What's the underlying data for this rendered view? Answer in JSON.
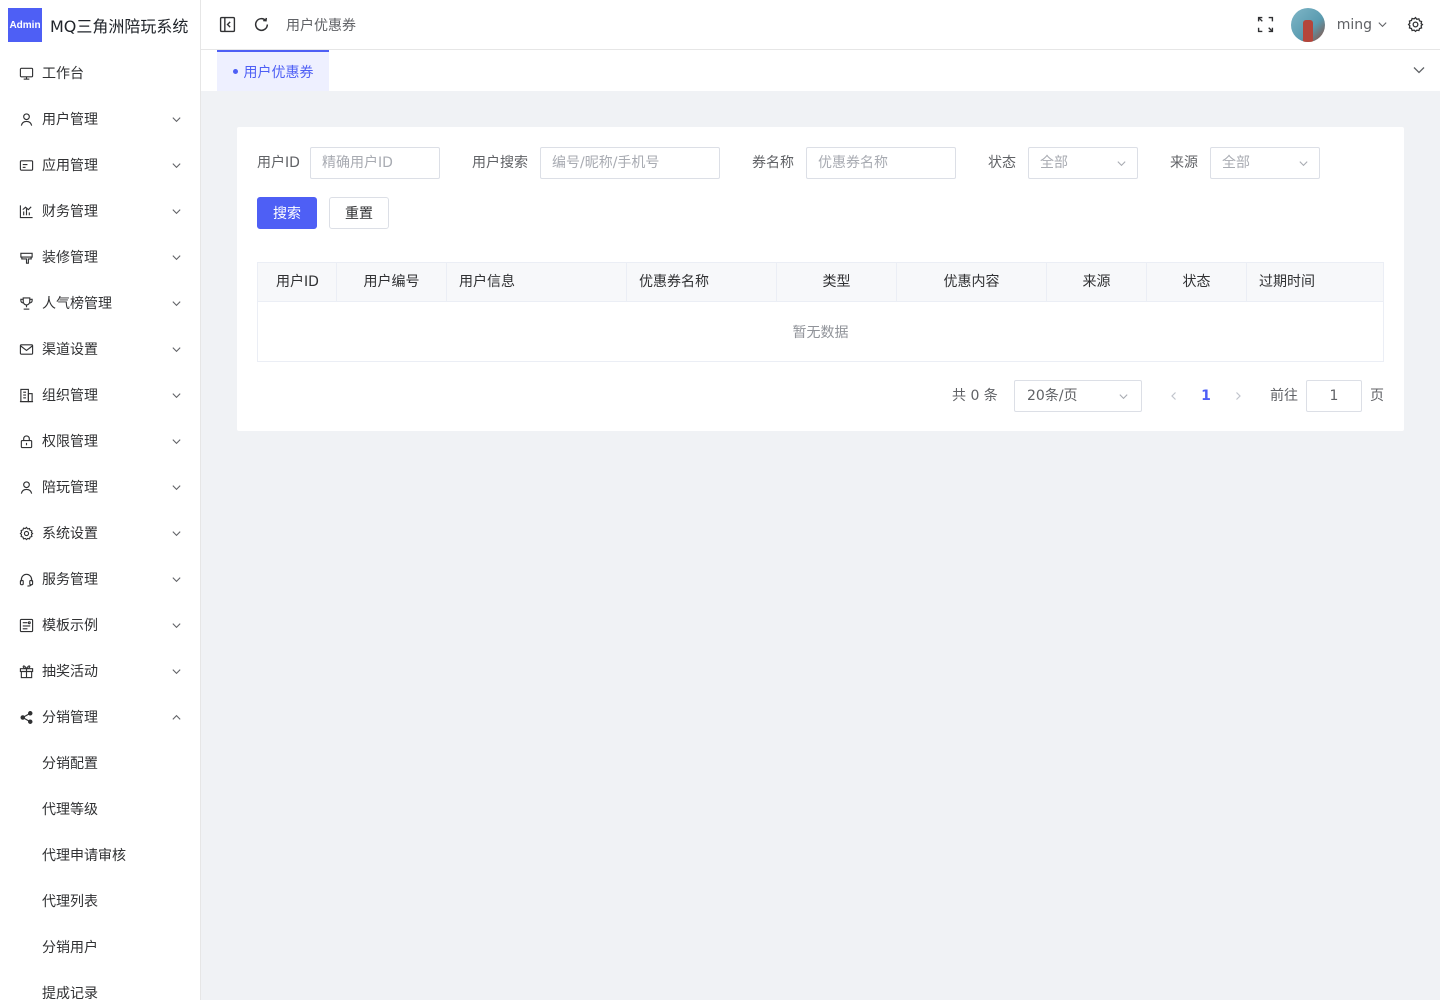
{
  "app": {
    "logo_badge": "Admin",
    "title": "MQ三角洲陪玩系统"
  },
  "sidebar": {
    "items": [
      {
        "label": "工作台",
        "icon": "monitor-icon",
        "arrow": ""
      },
      {
        "label": "用户管理",
        "icon": "user-icon",
        "arrow": "down"
      },
      {
        "label": "应用管理",
        "icon": "app-card-icon",
        "arrow": "down"
      },
      {
        "label": "财务管理",
        "icon": "bar-chart-icon",
        "arrow": "down"
      },
      {
        "label": "装修管理",
        "icon": "brush-icon",
        "arrow": "down"
      },
      {
        "label": "人气榜管理",
        "icon": "trophy-icon",
        "arrow": "down"
      },
      {
        "label": "渠道设置",
        "icon": "mail-icon",
        "arrow": "down"
      },
      {
        "label": "组织管理",
        "icon": "office-building-icon",
        "arrow": "down"
      },
      {
        "label": "权限管理",
        "icon": "lock-icon",
        "arrow": "down"
      },
      {
        "label": "陪玩管理",
        "icon": "user-icon",
        "arrow": "down"
      },
      {
        "label": "系统设置",
        "icon": "gear-icon",
        "arrow": "down"
      },
      {
        "label": "服务管理",
        "icon": "headset-icon",
        "arrow": "down"
      },
      {
        "label": "模板示例",
        "icon": "template-icon",
        "arrow": "down"
      },
      {
        "label": "抽奖活动",
        "icon": "gift-icon",
        "arrow": "down"
      },
      {
        "label": "分销管理",
        "icon": "share-icon",
        "arrow": "up"
      }
    ],
    "subitems": [
      {
        "label": "分销配置"
      },
      {
        "label": "代理等级"
      },
      {
        "label": "代理申请审核"
      },
      {
        "label": "代理列表"
      },
      {
        "label": "分销用户"
      },
      {
        "label": "提成记录"
      }
    ]
  },
  "header": {
    "breadcrumb": "用户优惠券",
    "username": "ming"
  },
  "tabs": [
    {
      "label": "用户优惠券",
      "active": true
    }
  ],
  "filters": {
    "user_id": {
      "label": "用户ID",
      "placeholder": "精确用户ID"
    },
    "user_search": {
      "label": "用户搜索",
      "placeholder": "编号/昵称/手机号"
    },
    "coupon_name": {
      "label": "券名称",
      "placeholder": "优惠券名称"
    },
    "status": {
      "label": "状态",
      "value": "全部"
    },
    "source": {
      "label": "来源",
      "value": "全部"
    },
    "search_label": "搜索",
    "reset_label": "重置"
  },
  "table": {
    "columns": [
      "用户ID",
      "用户编号",
      "用户信息",
      "优惠券名称",
      "类型",
      "优惠内容",
      "来源",
      "状态",
      "过期时间"
    ],
    "rows": [],
    "empty_text": "暂无数据"
  },
  "pagination": {
    "total_text": "共 0 条",
    "page_size": "20条/页",
    "current_page": "1",
    "goto_label": "前往",
    "goto_value": "1",
    "page_suffix": "页"
  },
  "colors": {
    "primary": "#4e5ff5",
    "background": "#f0f2f5"
  }
}
